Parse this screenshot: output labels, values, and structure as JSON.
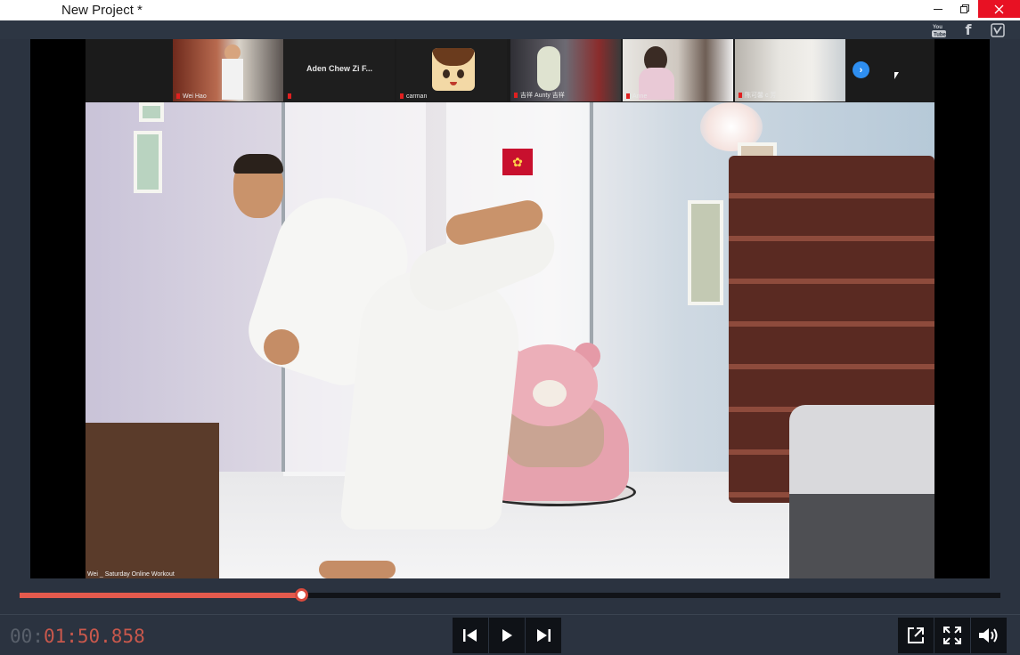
{
  "window": {
    "title": "New Project *"
  },
  "share": {
    "youtube_label": "You\nTube",
    "facebook_label": "f"
  },
  "meeting": {
    "participants": [
      {
        "name": "Wei Hao",
        "display": ""
      },
      {
        "name": "",
        "display": "Aden Chew Zi F..."
      },
      {
        "name": "carman",
        "display": ""
      },
      {
        "name": "吉祥 Aunty 吉祥",
        "display": ""
      },
      {
        "name": "Anne",
        "display": ""
      },
      {
        "name": "陈可馨 c 芳",
        "display": ""
      }
    ],
    "active_speaker_caption": "Wei _ Saturday Online Workout"
  },
  "playback": {
    "timecode_dim": "00:",
    "timecode_lit": "01:50.858",
    "progress": 0.287
  },
  "colors": {
    "accent": "#e45a4d",
    "close": "#e81123",
    "zoom_blue": "#2e8ef0"
  },
  "icons": [
    "minimize-icon",
    "maximize-icon",
    "close-icon",
    "youtube-icon",
    "facebook-icon",
    "vimeo-icon",
    "prev-frame-icon",
    "play-icon",
    "next-frame-icon",
    "external-preview-icon",
    "fullscreen-icon",
    "volume-icon"
  ]
}
